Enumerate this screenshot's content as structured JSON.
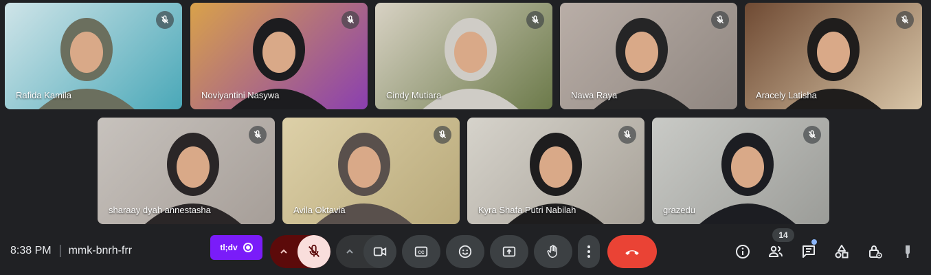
{
  "meeting": {
    "time": "8:38 PM",
    "code": "mmk-bnrh-frr"
  },
  "participants": [
    {
      "name": "Rafida Kamila",
      "bg": "#cfe4e8",
      "accent": "#4aa8b8",
      "scarf": "#6b6f5e"
    },
    {
      "name": "Noviyantini Nasywa",
      "bg": "#d9a24a",
      "accent": "#8a3fb0",
      "scarf": "#1c1c1f"
    },
    {
      "name": "Cindy Mutiara",
      "bg": "#d8d2c4",
      "accent": "#6c7a4a",
      "scarf": "#cfccc6"
    },
    {
      "name": "Nawa Raya",
      "bg": "#b9aea7",
      "accent": "#8f8680",
      "scarf": "#252526"
    },
    {
      "name": "Aracely Latisha",
      "bg": "#6f4a33",
      "accent": "#d9c6a8",
      "scarf": "#1f1d1c"
    },
    {
      "name": "sharaay dyah annestasha",
      "bg": "#c7c2bd",
      "accent": "#a69e98",
      "scarf": "#2a2627"
    },
    {
      "name": "Avila Oktavia",
      "bg": "#ddd0a8",
      "accent": "#b8a97a",
      "scarf": "#59504c"
    },
    {
      "name": "Kyra Shafa Putri Nabilah",
      "bg": "#d6d3cb",
      "accent": "#a7a198",
      "scarf": "#1e1d1e"
    },
    {
      "name": "grazedu",
      "bg": "#c9cac6",
      "accent": "#9b9c98",
      "scarf": "#1c1d22"
    }
  ],
  "controls": {
    "tldv_label": "tl;dv",
    "participants_count": "14"
  },
  "colors": {
    "background": "#202124",
    "leave": "#ea4335",
    "mic_off": "#f9dedc",
    "tldv": "#7a1cf9"
  },
  "icons": {
    "tile_badge": "mic-off-icon",
    "buttons": [
      "chevron-up-icon",
      "mic-off-icon",
      "videocam-icon",
      "closed-caption-icon",
      "emoji-icon",
      "present-screen-icon",
      "raise-hand-icon",
      "more-vert-icon",
      "call-end-icon"
    ],
    "right": [
      "info-icon",
      "people-icon",
      "chat-icon",
      "activities-icon",
      "host-controls-icon",
      "lightbulb-icon"
    ]
  }
}
